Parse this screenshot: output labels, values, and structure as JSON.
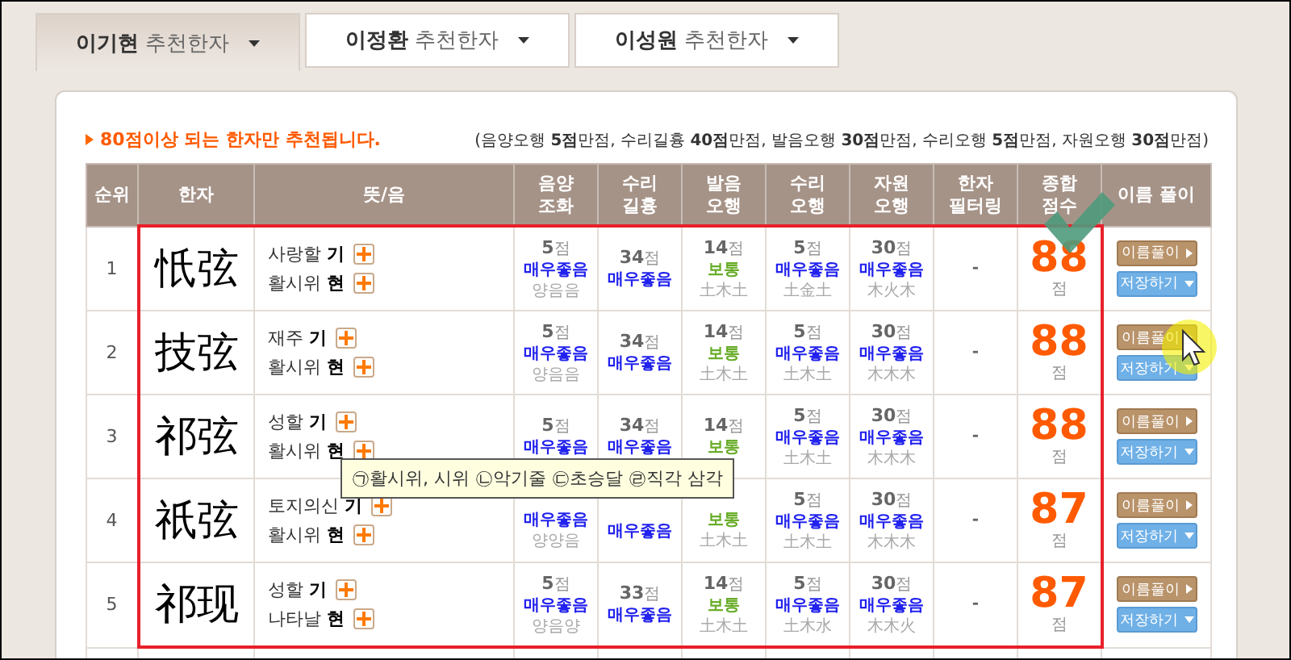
{
  "tabs": [
    {
      "label": "**이기현** 추천한자",
      "selected": true
    },
    {
      "label": "**이정환** 추천한자",
      "selected": false
    },
    {
      "label": "**이성원** 추천한자",
      "selected": false
    }
  ],
  "notice": "80점이상 되는 한자만 추천됩니다.",
  "max_scores": "(음양오행 **5점**만점, 수리길흉 **40점**만점, 발음오행 **30점**만점, 수리오행 **5점**만점, 자원오행 **30점**만점)",
  "table": {
    "columns": [
      "순위",
      "한자",
      "뜻/음",
      "음양 조화",
      "수리 길흉",
      "발음 오행",
      "수리 오행",
      "자원 오행",
      "한자 필터링",
      "종합 점수",
      "이름 풀이"
    ],
    "rows": [
      {
        "rank": "1",
        "hanja": "忯弦",
        "highlighted": true,
        "meanings": [
          {
            "meaning": "사랑할",
            "sound": "기"
          },
          {
            "meaning": "활시위",
            "sound": "현"
          }
        ],
        "scores": [
          {
            "score": "**5**점",
            "grade": "매우좋음",
            "kind": "very_good",
            "sub": "양음음"
          },
          {
            "score": "**34**점",
            "grade": "매우좋음",
            "kind": "very_good"
          },
          {
            "score": "**14**점",
            "grade": "보통",
            "kind": "normal",
            "sub": "土木土"
          },
          {
            "score": "**5**점",
            "grade": "매우좋음",
            "kind": "very_good",
            "sub": "土金土"
          },
          {
            "score": "**30**점",
            "grade": "매우좋음",
            "kind": "very_good",
            "sub": "木火木"
          }
        ],
        "filter": "-",
        "total": "88",
        "unit": "점",
        "buttons": [
          {
            "label": "이름풀이",
            "kind": "interpret"
          },
          {
            "label": "저장하기",
            "kind": "save"
          }
        ]
      },
      {
        "rank": "2",
        "hanja": "技弦",
        "highlighted": true,
        "meanings": [
          {
            "meaning": "재주",
            "sound": "기"
          },
          {
            "meaning": "활시위",
            "sound": "현"
          }
        ],
        "scores": [
          {
            "score": "**5**점",
            "grade": "매우좋음",
            "kind": "very_good",
            "sub": "양음음"
          },
          {
            "score": "**34**점",
            "grade": "매우좋음",
            "kind": "very_good"
          },
          {
            "score": "**14**점",
            "grade": "보통",
            "kind": "normal",
            "sub": "土木土"
          },
          {
            "score": "**5**점",
            "grade": "매우좋음",
            "kind": "very_good",
            "sub": "土木土"
          },
          {
            "score": "**30**점",
            "grade": "매우좋음",
            "kind": "very_good",
            "sub": "木木木"
          }
        ],
        "filter": "-",
        "total": "88",
        "unit": "점",
        "buttons": [
          {
            "label": "이름풀이",
            "kind": "interpret"
          },
          {
            "label": "저장하기",
            "kind": "save"
          }
        ]
      },
      {
        "rank": "3",
        "hanja": "祁弦",
        "highlighted": true,
        "meanings": [
          {
            "meaning": "성할",
            "sound": "기"
          },
          {
            "meaning": "활시위",
            "sound": "현"
          }
        ],
        "scores": [
          {
            "score": "**5**점",
            "grade": "매우좋음",
            "kind": "very_good"
          },
          {
            "score": "**34**점",
            "grade": "매우좋음",
            "kind": "very_good"
          },
          {
            "score": "**14**점",
            "grade": "보통",
            "kind": "normal"
          },
          {
            "score": "**5**점",
            "grade": "매우좋음",
            "kind": "very_good",
            "sub": "土木土"
          },
          {
            "score": "**30**점",
            "grade": "매우좋음",
            "kind": "very_good",
            "sub": "木木木"
          }
        ],
        "filter": "-",
        "total": "88",
        "unit": "점",
        "buttons": [
          {
            "label": "이름풀이",
            "kind": "interpret"
          },
          {
            "label": "저장하기",
            "kind": "save"
          }
        ]
      },
      {
        "rank": "4",
        "hanja": "祇弦",
        "highlighted": true,
        "meanings": [
          {
            "meaning": "토지의신",
            "sound": "기"
          },
          {
            "meaning": "활시위",
            "sound": "현"
          }
        ],
        "scores": [
          {
            "grade": "매우좋음",
            "kind": "very_good",
            "sub": "양양음"
          },
          {
            "grade": "매우좋음",
            "kind": "very_good"
          },
          {
            "grade": "보통",
            "kind": "normal",
            "sub": "土木土"
          },
          {
            "score": "**5**점",
            "grade": "매우좋음",
            "kind": "very_good",
            "sub": "土木土"
          },
          {
            "score": "**30**점",
            "grade": "매우좋음",
            "kind": "very_good",
            "sub": "木木木"
          }
        ],
        "filter": "-",
        "total": "87",
        "unit": "점",
        "buttons": [
          {
            "label": "이름풀이",
            "kind": "interpret"
          },
          {
            "label": "저장하기",
            "kind": "save"
          }
        ]
      },
      {
        "rank": "5",
        "hanja": "祁现",
        "highlighted": true,
        "meanings": [
          {
            "meaning": "성할",
            "sound": "기"
          },
          {
            "meaning": "나타날",
            "sound": "현"
          }
        ],
        "scores": [
          {
            "score": "**5**점",
            "grade": "매우좋음",
            "kind": "very_good",
            "sub": "양음양"
          },
          {
            "score": "**33**점",
            "grade": "매우좋음",
            "kind": "very_good"
          },
          {
            "score": "**14**점",
            "grade": "보통",
            "kind": "normal",
            "sub": "土木土"
          },
          {
            "score": "**5**점",
            "grade": "매우좋음",
            "kind": "very_good",
            "sub": "土木水"
          },
          {
            "score": "**30**점",
            "grade": "매우좋음",
            "kind": "very_good",
            "sub": "木木火"
          }
        ],
        "filter": "-",
        "total": "87",
        "unit": "점",
        "buttons": [
          {
            "label": "이름풀이",
            "kind": "interpret"
          },
          {
            "label": "저장하기",
            "kind": "save"
          }
        ]
      }
    ]
  },
  "tooltip": "㉠활시위, 시위 ㉡악기줄 ㉢초승달 ㉣직각 삼각"
}
